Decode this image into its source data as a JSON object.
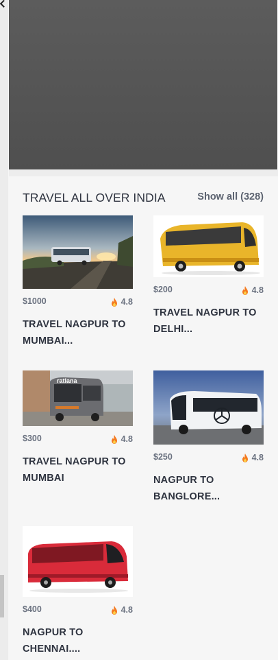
{
  "section": {
    "title": "TRAVEL ALL OVER INDIA",
    "show_all": "Show all (328)"
  },
  "cards": [
    {
      "price": "$1000",
      "rating": "4.8",
      "title": "TRAVEL NAGPUR TO MUMBAI...",
      "image": "sunset-highway-bus"
    },
    {
      "price": "$200",
      "rating": "4.8",
      "title": "TRAVEL NAGPUR TO DELHI...",
      "image": "yellow-coach-bus"
    },
    {
      "price": "$300",
      "rating": "4.8",
      "title": "TRAVEL NAGPUR TO MUMBAI",
      "image": "grey-bus-depot",
      "image_text": "ratlana"
    },
    {
      "price": "$250",
      "rating": "4.8",
      "title": "NAGPUR TO BANGLORE...",
      "image": "white-coach-bus"
    },
    {
      "price": "$400",
      "rating": "4.8",
      "title": "NAGPUR TO CHENNAI....",
      "image": "red-coach-bus"
    }
  ],
  "colors": {
    "background": "#f6f6f6",
    "hero": "#555555",
    "title_text": "#2f3440",
    "muted_text": "#6b7280",
    "flame": "#f47a20"
  },
  "icons": {
    "rating": "fire-icon"
  }
}
